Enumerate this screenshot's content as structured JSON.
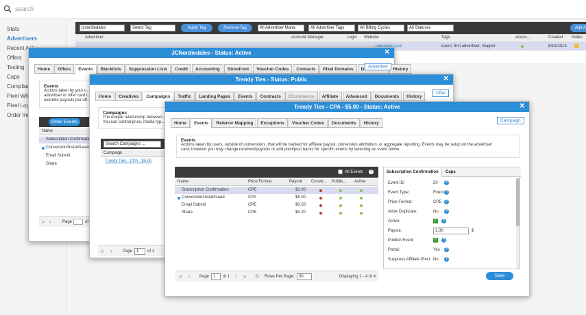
{
  "search": {
    "placeholder": "search"
  },
  "nav": [
    "Stats",
    "Advertisers",
    "Recent Acti...",
    "Offers",
    "Testing",
    "Caps",
    "Complian...",
    "Pixel White...",
    "Pixel Log",
    "Order Inqu..."
  ],
  "toolbar": {
    "search_value": "jcnordiedales",
    "select_tag": "Select Tag",
    "apply_tag": "Apply Tag",
    "remove_tag": "Remove Tag",
    "all_adv_mana": "All Advertiser Mana",
    "all_adv_tags": "All Advertiser Tags",
    "all_billing": "All Billing Cycles",
    "all_statuses": "All Statuses",
    "add": "Add A"
  },
  "list": {
    "headers": [
      "Advertiser",
      "Account Manager",
      "Login",
      "Website",
      "Tags",
      "Accou...",
      "Created",
      "Notes"
    ],
    "row": {
      "tags": "karen, first advertiser, Nugent",
      "created": "8/15/2013",
      "website": "...ndiedales.com"
    }
  },
  "modal1": {
    "title": "JCNordiedales - Status: Active",
    "tabs": [
      "Home",
      "Offers",
      "Events",
      "Blacklists",
      "Suppression Lists",
      "Credit",
      "Accounting",
      "Storefront",
      "Voucher Codes",
      "Contacts",
      "Pixel Domains",
      "Documents",
      "History"
    ],
    "link": "Advertiser",
    "desc_h": "Events",
    "desc_t": [
      "Actions taken by your u...",
      "advertiser or offer card i...",
      "override payouts per off..."
    ],
    "order_btn": "Order Events",
    "col": "Name",
    "rows": [
      "Subscription Confirmatio...",
      "Conversion/Install/Lead",
      "Email Submit",
      "Share"
    ],
    "page_label": "Page",
    "page_of": "of"
  },
  "modal2": {
    "title": "Trendy Ties - Status: Public",
    "tabs": [
      "Home",
      "Creatives",
      "Campaigns",
      "Traffic",
      "Landing Pages",
      "Events",
      "Contracts",
      "ECommerce",
      "Affiliate",
      "Advanced",
      "Documents",
      "History"
    ],
    "link": "Offer",
    "desc_h": "Campaigns",
    "desc_t": [
      "The unique relationship between...",
      "You can control price, media typ..."
    ],
    "search_ph": "Search Campaigns ...",
    "col": "Campaign",
    "row": "Trendy Ties - CPA - $5.00",
    "page_label": "Page",
    "page_val": "1",
    "page_of": "of 1"
  },
  "modal3": {
    "title": "Trendy Ties - CPA - $5.00 - Status: Active",
    "tabs": [
      "Home",
      "Events",
      "Referrer Mapping",
      "Exceptions",
      "Voucher Codes",
      "Documents",
      "History"
    ],
    "link": "Campaign",
    "desc_h": "Events",
    "desc_t": [
      "Actions taken by users, outside of conversions, that will be tracked for affiliate payout, conversion attribution, or aggregate reporting. Events may be setup on the advertiser",
      "card; however you may change received/payouts or add pixel/post backs for specific events by selecting an event below."
    ],
    "all_events": "All Events",
    "cols": [
      "Name",
      "Price Format",
      "Payout",
      "Conve...",
      "Publis...",
      "Active"
    ],
    "rows": [
      {
        "name": "Subscription Confirmation",
        "fmt": "CPE",
        "pay": "$1.00",
        "c": "#c0392b",
        "p": "#8bc34a",
        "a": "#8bc34a"
      },
      {
        "name": "Conversion/Install/Lead",
        "fmt": "CPA",
        "pay": "$5.00",
        "c": "#c0392b",
        "p": "#8bc34a",
        "a": "#8bc34a"
      },
      {
        "name": "Email Submit",
        "fmt": "CPE",
        "pay": "$0.50",
        "c": "#c0392b",
        "p": "#8bc34a",
        "a": "#8bc34a"
      },
      {
        "name": "Share",
        "fmt": "CPE",
        "pay": "$0.20",
        "c": "#c0392b",
        "p": "#8bc34a",
        "a": "#8bc34a"
      }
    ],
    "pager": {
      "page": "Page",
      "val": "1",
      "of": "of 1",
      "rpp": "Rows Per Page:",
      "rpp_val": "30",
      "display": "Displaying 1 - 4 of 4"
    },
    "side_tabs": [
      "Subscription Confirmation",
      "Caps"
    ],
    "props": [
      {
        "label": "Event ID:",
        "value": "20"
      },
      {
        "label": "Event Type:",
        "value": "Event"
      },
      {
        "label": "Price Format:",
        "value": "CPE"
      },
      {
        "label": "Allow Duplicate:",
        "value": "No"
      },
      {
        "label": "Active:",
        "value": ""
      },
      {
        "label": "Payout:",
        "value": "1.00"
      },
      {
        "label": "Publish Event:",
        "value": ""
      },
      {
        "label": "Portal:",
        "value": "Yes"
      },
      {
        "label": "Suppress Affiliate Pixel:",
        "value": "No"
      }
    ],
    "currency": "$",
    "save": "Save"
  }
}
